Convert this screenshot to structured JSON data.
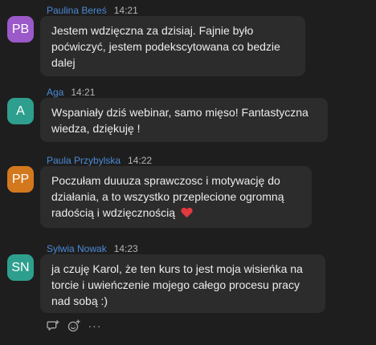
{
  "messages": [
    {
      "initials": "PB",
      "avatar_color": "#9b59c9",
      "sender": "Paulina Bereś",
      "time": "14:21",
      "lines": [
        "Jestem wdzięczna za dzisiaj. Fajnie było",
        "poćwiczyć, jestem podekscytowana co bedzie",
        "dalej"
      ]
    },
    {
      "initials": "A",
      "avatar_color": "#2e9f8e",
      "sender": "Aga",
      "time": "14:21",
      "lines": [
        "Wspaniały dziś webinar, samo mięso! Fantastyczna",
        "wiedza, dziękuję !"
      ]
    },
    {
      "initials": "PP",
      "avatar_color": "#d4781e",
      "sender": "Paula Przybylska",
      "time": "14:22",
      "lines": [
        "Poczułam duuuza sprawczosc i motywację do",
        "działania, a to wszystko przeplecione ogromną",
        "radością i wdzięcznością"
      ],
      "emoji": "heart"
    },
    {
      "initials": "SN",
      "avatar_color": "#2e9f8e",
      "sender": "Sylwia Nowak",
      "time": "14:23",
      "lines": [
        "ja czuję Karol, że ten kurs to jest moja wisieńka na",
        "torcie i uwieńczenie mojego całego procesu pracy",
        "nad sobą :)"
      ]
    }
  ],
  "actions": {
    "reply_icon": "reply-icon",
    "react_icon": "add-reaction-icon",
    "more_label": "···"
  },
  "colors": {
    "background": "#1e1e1e",
    "bubble": "#2c2c2c",
    "sender_name": "#4b8ad6",
    "heart": "#e0393e"
  }
}
